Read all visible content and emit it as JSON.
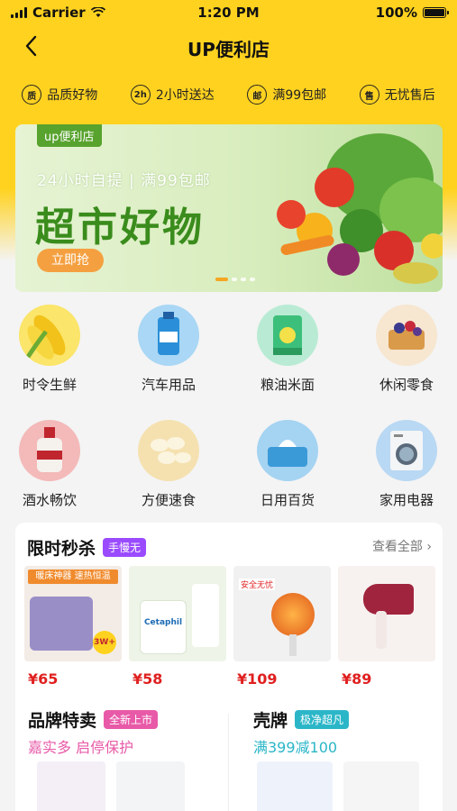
{
  "status_bar": {
    "carrier": "Carrier",
    "time": "1:20 PM",
    "battery": "100%"
  },
  "nav": {
    "title": "UP便利店"
  },
  "features": [
    {
      "icon": "quality-icon",
      "glyph": "质",
      "label": "品质好物"
    },
    {
      "icon": "delivery-icon",
      "glyph": "2h",
      "label": "2小时送达"
    },
    {
      "icon": "postage-icon",
      "glyph": "邮",
      "label": "满99包邮"
    },
    {
      "icon": "aftersale-icon",
      "glyph": "售",
      "label": "无忧售后"
    }
  ],
  "banner": {
    "tag": "up便利店",
    "subtitle": "24小时自提 | 满99包邮",
    "headline": "超市好物",
    "cta": "立即抢"
  },
  "categories": [
    {
      "label": "时令生鲜",
      "icon": "corn-icon"
    },
    {
      "label": "汽车用品",
      "icon": "washer-fluid-icon"
    },
    {
      "label": "粮油米面",
      "icon": "rice-bag-icon"
    },
    {
      "label": "休闲零食",
      "icon": "snack-icon"
    },
    {
      "label": "酒水畅饮",
      "icon": "liquor-icon"
    },
    {
      "label": "方便速食",
      "icon": "dumpling-icon"
    },
    {
      "label": "日用百货",
      "icon": "tissue-icon"
    },
    {
      "label": "家用电器",
      "icon": "washing-machine-icon"
    }
  ],
  "flash_sale": {
    "title": "限时秒杀",
    "badge": "手慢无",
    "more": "查看全部",
    "products": [
      {
        "price": "¥65",
        "img_text": "暖床神器 速热恒温",
        "badge": "3W+"
      },
      {
        "price": "¥58",
        "img_text": "Cetaphil"
      },
      {
        "price": "¥109",
        "img_text": "安全无忧"
      },
      {
        "price": "¥89",
        "img_text": ""
      }
    ]
  },
  "brand_sale": {
    "title": "品牌特卖",
    "badge": "全新上市",
    "desc": "嘉实多 启停保护"
  },
  "shell_brand": {
    "title": "壳牌",
    "badge": "极净超凡",
    "desc": "满399减100"
  },
  "colors": {
    "brand_yellow": "#ffd21f",
    "price_red": "#e02020",
    "purple": "#9a4bff",
    "pink": "#e85aa8",
    "teal": "#2bb6c8"
  }
}
